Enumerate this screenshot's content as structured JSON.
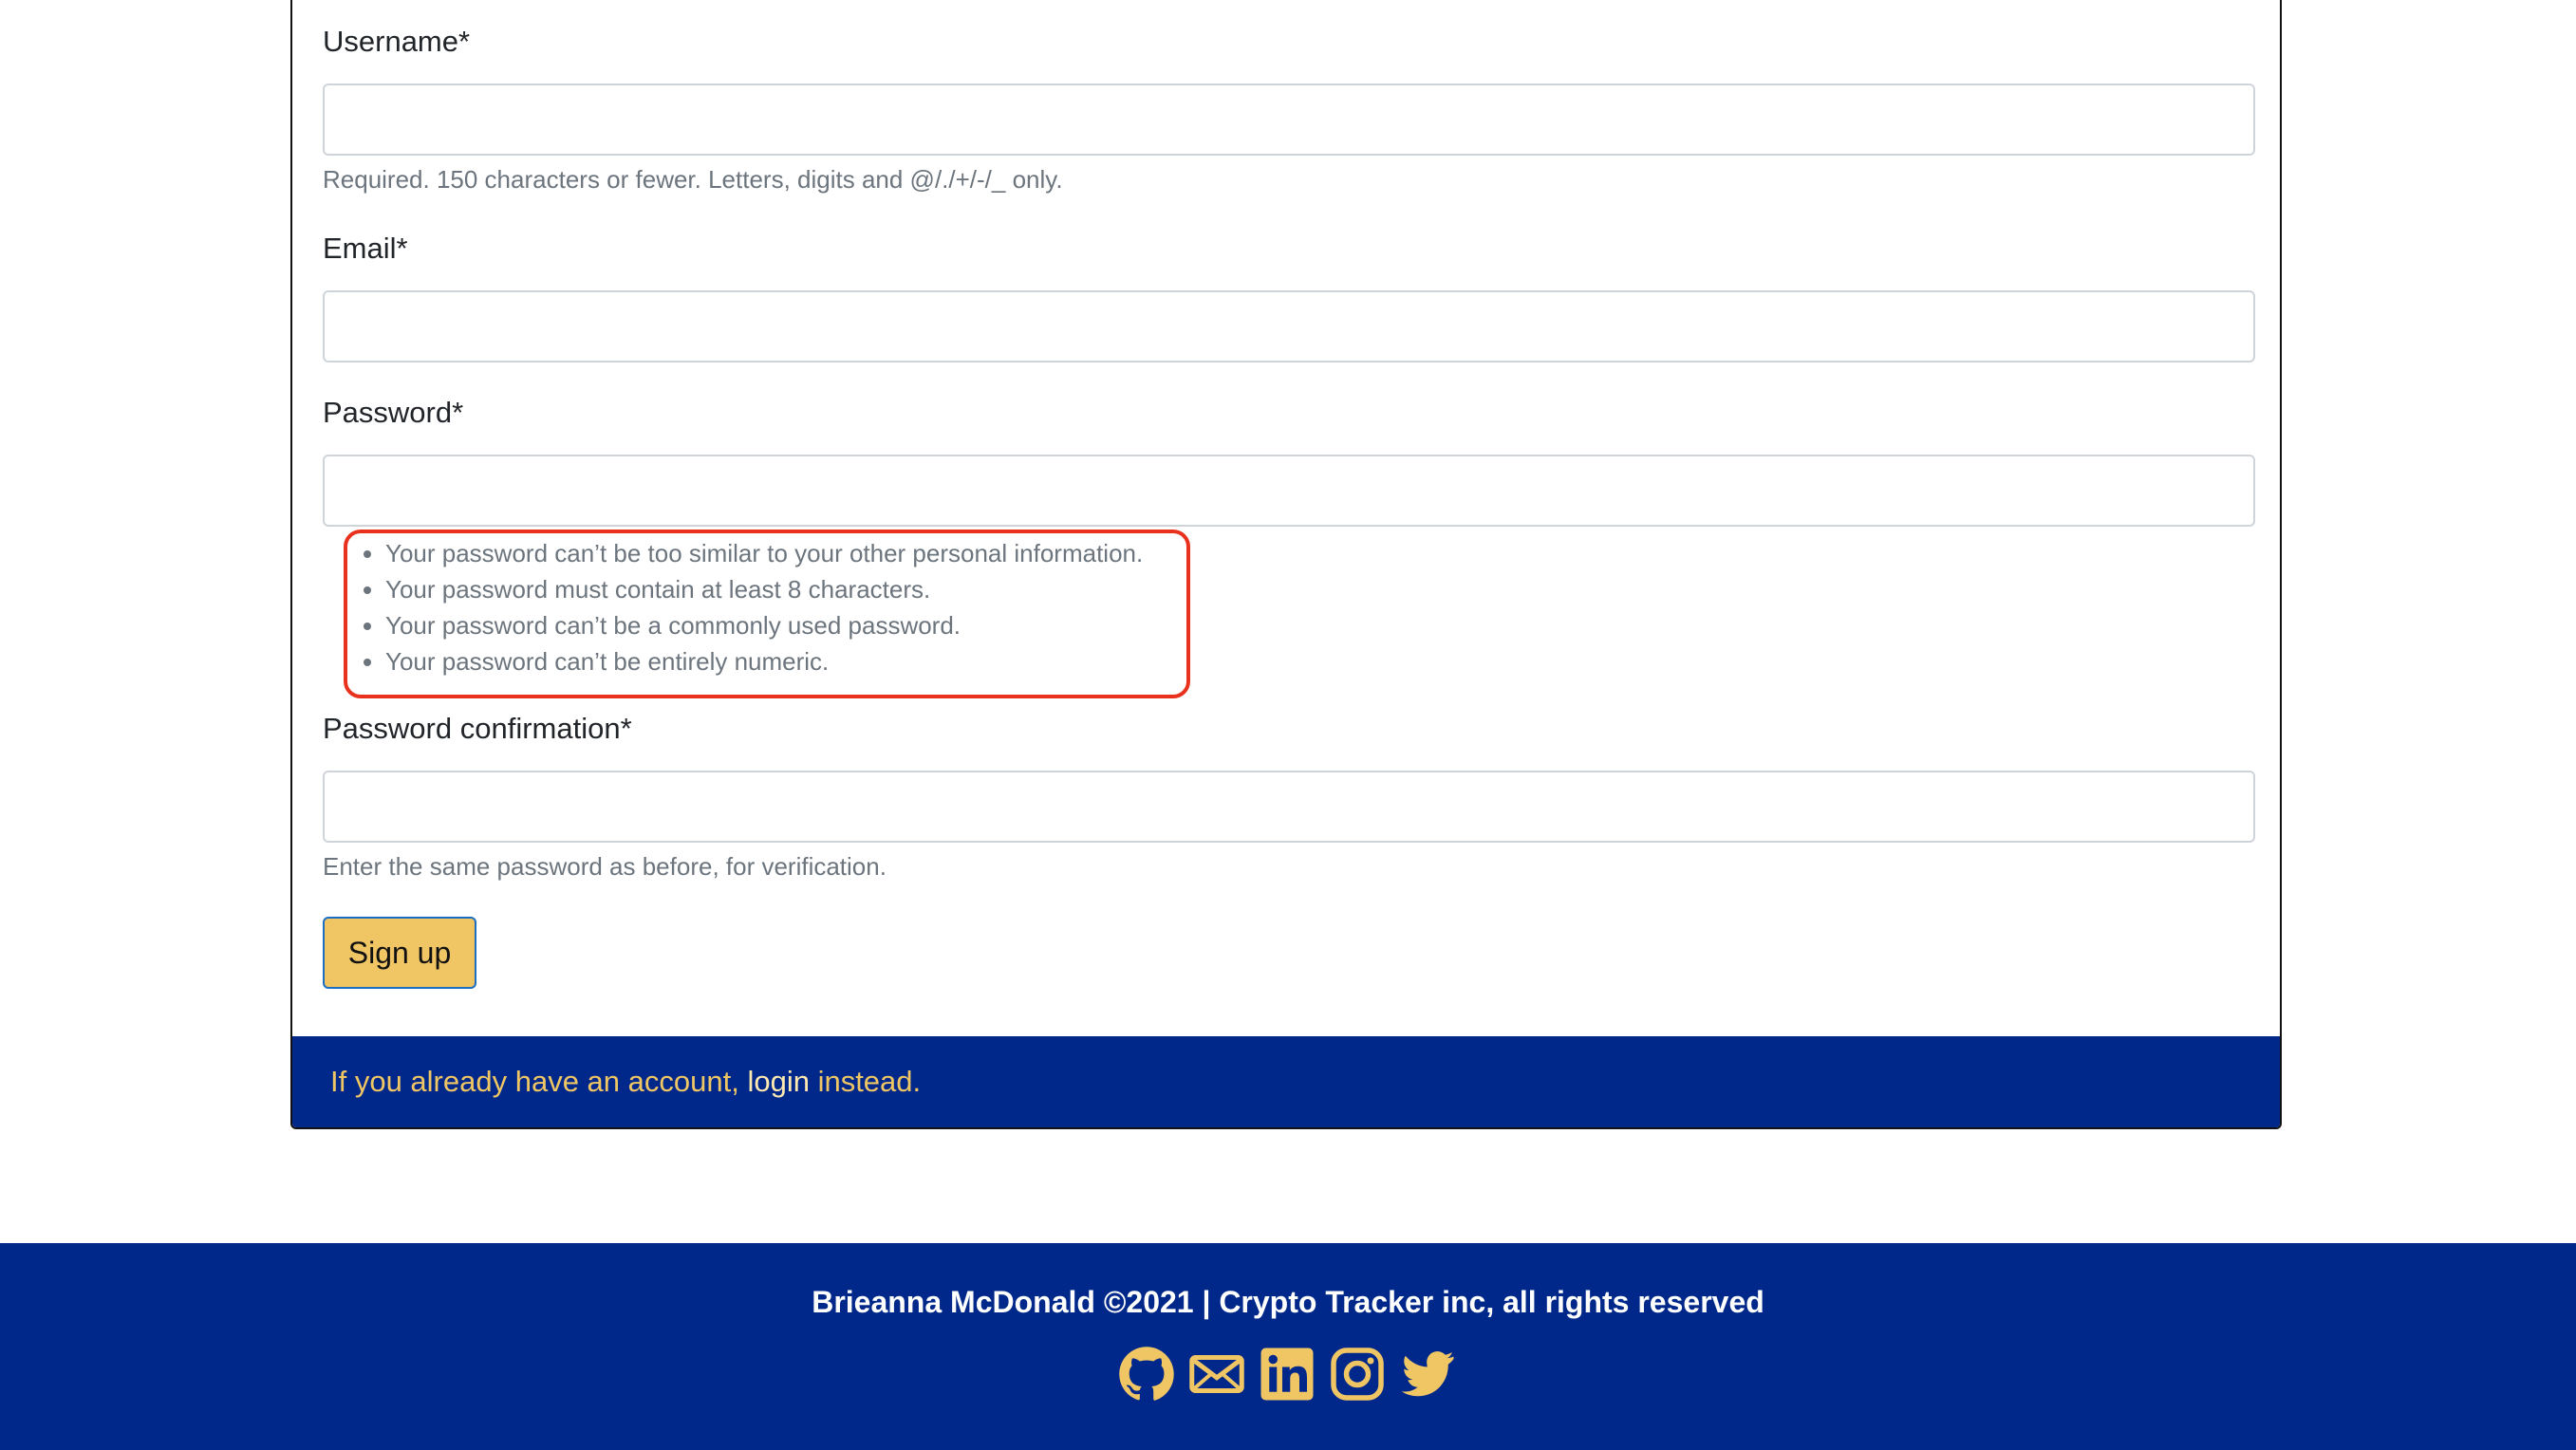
{
  "form": {
    "username_label": "Username*",
    "username_help": "Required. 150 characters or fewer. Letters, digits and @/./+/-/_ only.",
    "email_label": "Email*",
    "password_label": "Password*",
    "password_rules": [
      "Your password can’t be too similar to your other personal information.",
      "Your password must contain at least 8 characters.",
      "Your password can’t be a commonly used password.",
      "Your password can’t be entirely numeric."
    ],
    "password_confirmation_label": "Password confirmation*",
    "password_confirmation_help": "Enter the same password as before, for verification.",
    "submit_label": "Sign up"
  },
  "card_footer": {
    "text_before": "If you already have an account, ",
    "link_label": "login",
    "text_after": " instead."
  },
  "site_footer": {
    "copyright": "Brieanna McDonald ©2021 | Crypto Tracker inc, all rights reserved",
    "social_icons": [
      "github-icon",
      "mail-icon",
      "linkedin-icon",
      "instagram-icon",
      "twitter-icon"
    ]
  },
  "colors": {
    "navy": "#00288a",
    "gold": "#f0c665",
    "highlight_border": "#e8321e"
  }
}
